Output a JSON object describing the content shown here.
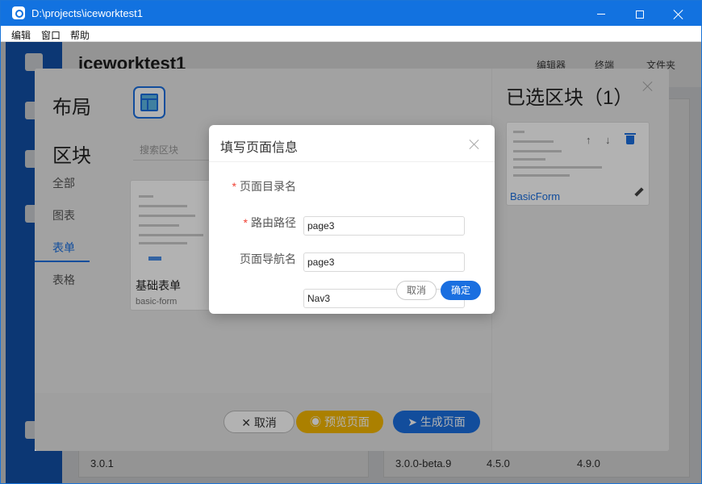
{
  "window": {
    "title": "D:\\projects\\iceworktest1"
  },
  "menubar": {
    "items": [
      "编辑",
      "窗口",
      "帮助"
    ]
  },
  "background": {
    "project_name": "iceworktest1",
    "tools": [
      "编辑器",
      "终端",
      "文件夹"
    ],
    "versions": [
      "3.0.1",
      "3.0.0-beta.9",
      "4.5.0",
      "4.9.0"
    ]
  },
  "panel": {
    "layout_title": "布局",
    "blocks_title": "区块",
    "search_placeholder": "搜索区块",
    "categories": [
      "全部",
      "图表",
      "表单",
      "表格"
    ],
    "active_category_index": 2,
    "block": {
      "name": "基础表单",
      "sub": "basic-form"
    },
    "selected_title": "已选区块（1）",
    "selected_block_label": "BasicForm",
    "buttons": {
      "cancel": "取消",
      "preview": "预览页面",
      "generate": "生成页面"
    },
    "colors": {
      "accent": "#1a6fe0",
      "preview": "#f5b800"
    }
  },
  "modal": {
    "title": "填写页面信息",
    "fields": [
      {
        "label": "页面目录名",
        "required": true,
        "value": "page3"
      },
      {
        "label": "路由路径",
        "required": true,
        "value": "page3"
      },
      {
        "label": "页面导航名",
        "required": false,
        "value": "Nav3"
      }
    ],
    "cancel_label": "取消",
    "ok_label": "确定"
  }
}
